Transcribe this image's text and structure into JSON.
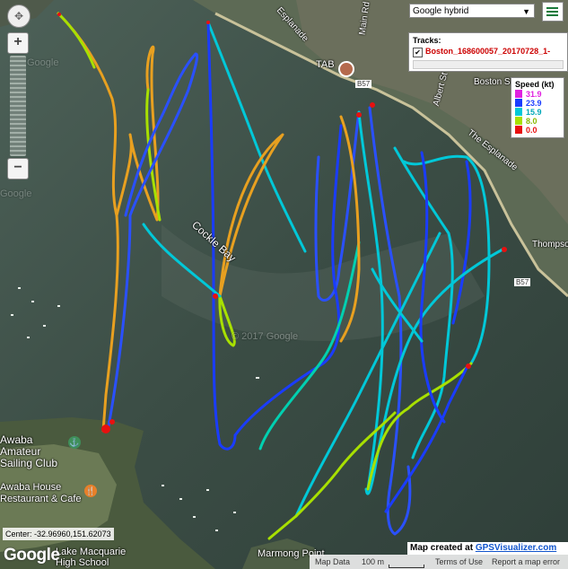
{
  "map": {
    "type_select": "Google hybrid",
    "copyright_watermark": "© 2017 Google",
    "places": [
      "Esplanade",
      "Main Rd",
      "TAB",
      "B57",
      "Albert St",
      "Boston St",
      "The Esplanade",
      "Thompson",
      "B57",
      "Cockle Bay",
      "Awaba Amateur Sailing Club",
      "Awaba House Restaurant & Cafe",
      "Lake Macquarie High School",
      "Marmong Point",
      "Google",
      "Google",
      "Google"
    ]
  },
  "tracks_panel": {
    "title": "Tracks:",
    "track_name": "Boston_168600057_20170728_1-"
  },
  "legend": {
    "title": "Speed (kt)",
    "items": [
      {
        "label": "31.9",
        "color": "#e020e0"
      },
      {
        "label": "23.9",
        "color": "#1a3cff"
      },
      {
        "label": "15.9",
        "color": "#00c8d8"
      },
      {
        "label": "8.0",
        "color": "#a8e000"
      },
      {
        "label": "0.0",
        "color": "#e81010"
      }
    ]
  },
  "footer": {
    "google_logo": "Google",
    "center": "Center: -32.96960,151.62073",
    "created_prefix": "Map created at",
    "created_link": "GPSVisualizer.com",
    "map_data": "Map Data",
    "scale": "100 m",
    "terms": "Terms of Use",
    "report": "Report a map error"
  },
  "icons": [
    "pan-icon",
    "zoom-in-icon",
    "zoom-out-icon",
    "menu-icon",
    "checkbox-icon",
    "marker-icon"
  ]
}
